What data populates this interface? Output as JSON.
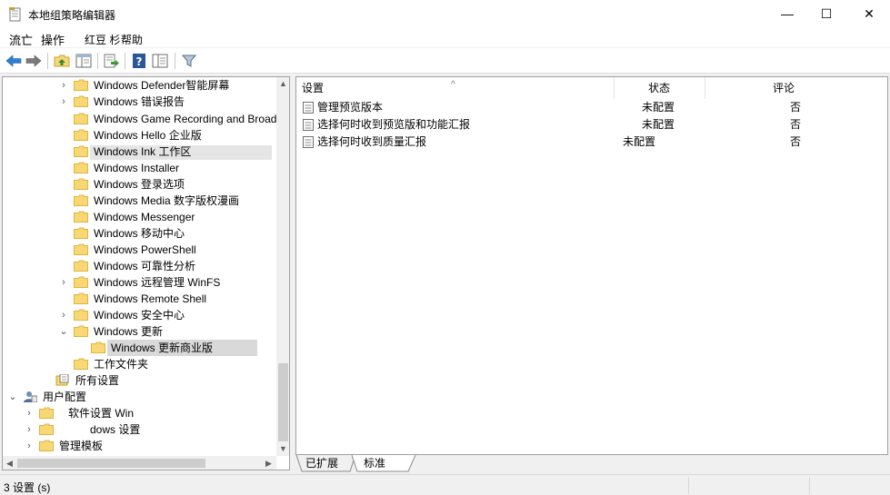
{
  "window": {
    "title": "本地组策略编辑器",
    "minimize": "—",
    "maximize": "☐",
    "close": "✕"
  },
  "menu": {
    "items": [
      "流亡",
      "操作",
      "红豆 杉",
      "帮助"
    ]
  },
  "toolbar": {
    "buttons": [
      "back-icon",
      "forward-icon",
      "up-folder-icon",
      "show-hide-tree-icon",
      "export-list-icon",
      "help-icon",
      "properties-view-icon",
      "filter-icon"
    ]
  },
  "tree": {
    "items": [
      {
        "label": "Windows Defender智能屏幕",
        "expander": "›"
      },
      {
        "label": "Windows 错误报告",
        "expander": "›"
      },
      {
        "label": "Windows Game Recording and Broad'",
        "expander": ""
      },
      {
        "label": "Windows Hello 企业版",
        "expander": ""
      },
      {
        "label": "Windows Ink 工作区",
        "expander": ""
      },
      {
        "label": "Windows Installer",
        "expander": ""
      },
      {
        "label": "Windows 登录选项",
        "expander": ""
      },
      {
        "label": "Windows Media 数字版权漫画",
        "expander": ""
      },
      {
        "label": "Windows Messenger",
        "expander": ""
      },
      {
        "label": "Windows 移动中心",
        "expander": ""
      },
      {
        "label": "Windows PowerShell",
        "expander": ""
      },
      {
        "label": "Windows 可靠性分析",
        "expander": ""
      },
      {
        "label": "Windows 远程管理 WinFS",
        "expander": "›"
      },
      {
        "label": "Windows Remote Shell",
        "expander": ""
      },
      {
        "label": "Windows 安全中心",
        "expander": "›"
      },
      {
        "label": "Windows 更新",
        "expander": "⌄"
      },
      {
        "label": "Windows 更新商业版",
        "expander": ""
      },
      {
        "label": "工作文件夹",
        "expander": ""
      },
      {
        "label": "所有设置",
        "expander": ""
      },
      {
        "label": "用户配置",
        "expander": "⌄"
      },
      {
        "label": "软件设置 Win",
        "expander": "›"
      },
      {
        "label": "dows 设置",
        "expander": "›"
      },
      {
        "label": "管理模板",
        "expander": "›"
      }
    ]
  },
  "list": {
    "columns": {
      "setting": "设置",
      "state": "状态",
      "comment": "评论"
    },
    "sort_indicator": "^",
    "rows": [
      {
        "name": "管理预览版本",
        "state": "未配置",
        "comment": "否"
      },
      {
        "name": "选择何时收到预览版和功能汇报",
        "state": "未配置",
        "comment": "否"
      },
      {
        "name": "选择何时收到质量汇报",
        "state": "未配置",
        "comment": "否"
      }
    ]
  },
  "tabs": {
    "extended": "已扩展",
    "standard": "标准"
  },
  "status": {
    "text": "3 设置 (s)"
  },
  "colors": {
    "folder": "#f8d775",
    "folder_dark": "#e0b440",
    "help_blue": "#2b5797",
    "back_blue": "#2f7fd0"
  }
}
